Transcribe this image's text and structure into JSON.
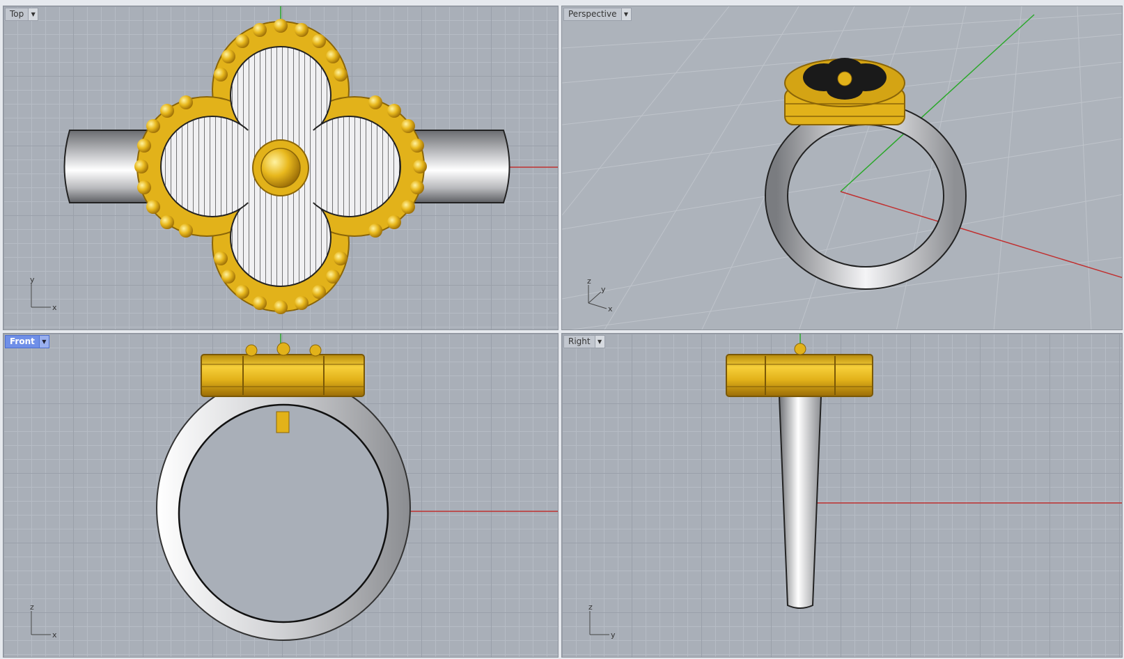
{
  "viewports": {
    "top": {
      "label": "Top",
      "axis_a": "y",
      "axis_b": "x"
    },
    "persp": {
      "label": "Perspective",
      "axis_a": "z",
      "axis_b": "y",
      "axis_c": "x"
    },
    "front": {
      "label": "Front",
      "axis_a": "z",
      "axis_b": "x"
    },
    "right": {
      "label": "Right",
      "axis_a": "z",
      "axis_b": "y"
    }
  },
  "colors": {
    "grid_bg": "#a9afb8",
    "gold": "#e2b21a",
    "silver": "#e8e8ea",
    "x_axis": "#c03030",
    "y_axis": "#2aa82a",
    "active_tab": "#6f8fe8"
  },
  "icons": {
    "dropdown": "chevron-down-icon"
  }
}
